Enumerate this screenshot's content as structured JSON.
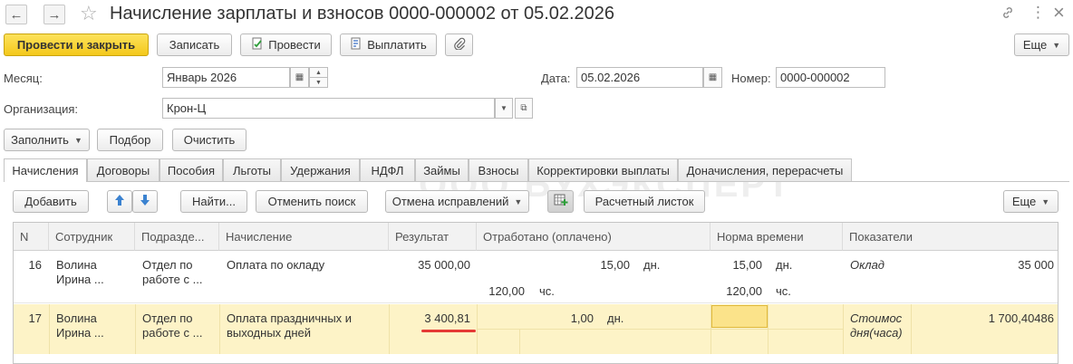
{
  "window": {
    "title": "Начисление зарплаты и взносов 0000-000002 от 05.02.2026",
    "back_icon": "←",
    "forward_icon": "→",
    "star_icon": "☆",
    "link_icon": "🔗",
    "more_icon": "⋮",
    "close_icon": "×"
  },
  "toolbar": {
    "post_close": "Провести и закрыть",
    "save": "Записать",
    "post": "Провести",
    "pay": "Выплатить",
    "more": "Еще"
  },
  "form": {
    "month_label": "Месяц:",
    "month_value": "Январь 2026",
    "date_label": "Дата:",
    "date_value": "05.02.2026",
    "number_label": "Номер:",
    "number_value": "0000-000002",
    "org_label": "Организация:",
    "org_value": "Крон-Ц"
  },
  "actions": {
    "fill": "Заполнить",
    "select": "Подбор",
    "clear": "Очистить"
  },
  "tabs": [
    "Начисления",
    "Договоры",
    "Пособия",
    "Льготы",
    "Удержания",
    "НДФЛ",
    "Займы",
    "Взносы",
    "Корректировки выплаты",
    "Доначисления, перерасчеты"
  ],
  "watermark": "ООО БУХЭКСПЕРТ",
  "table_toolbar": {
    "add": "Добавить",
    "find": "Найти...",
    "cancel_search": "Отменить поиск",
    "cancel_fix": "Отмена исправлений",
    "payslip": "Расчетный листок",
    "more": "Еще"
  },
  "columns": [
    "N",
    "Сотрудник",
    "Подразде...",
    "Начисление",
    "Результат",
    "Отработано (оплачено)",
    "Норма времени",
    "Показатели"
  ],
  "rows": [
    {
      "n": "16",
      "employee": [
        "Волина",
        "Ирина ..."
      ],
      "dept": [
        "Отдел по",
        "работе с ..."
      ],
      "accrual": [
        "Оплата по окладу",
        ""
      ],
      "result": "35 000,00",
      "worked_days": "15,00",
      "days_unit": "дн.",
      "worked_hours": "120,00",
      "hours_unit": "чс.",
      "norm_days": "15,00",
      "norm_days_unit": "дн.",
      "norm_hours": "120,00",
      "norm_hours_unit": "чс.",
      "indicator": "Оклад",
      "indicator_value": "35 000"
    },
    {
      "n": "17",
      "employee": [
        "Волина",
        "Ирина ..."
      ],
      "dept": [
        "Отдел по",
        "работе с ..."
      ],
      "accrual": [
        "Оплата праздничных и",
        "выходных дней"
      ],
      "result": "3 400,81",
      "worked_days": "1,00",
      "days_unit": "дн.",
      "indicator": [
        "Стоимос",
        "дня(часа)"
      ],
      "indicator_value": "1 700,40486"
    }
  ],
  "colors": {
    "primary_button": "#f4c81b",
    "selected_row": "#fdf3c7",
    "highlight_cell": "#fbe38a",
    "underline": "#e53935"
  }
}
